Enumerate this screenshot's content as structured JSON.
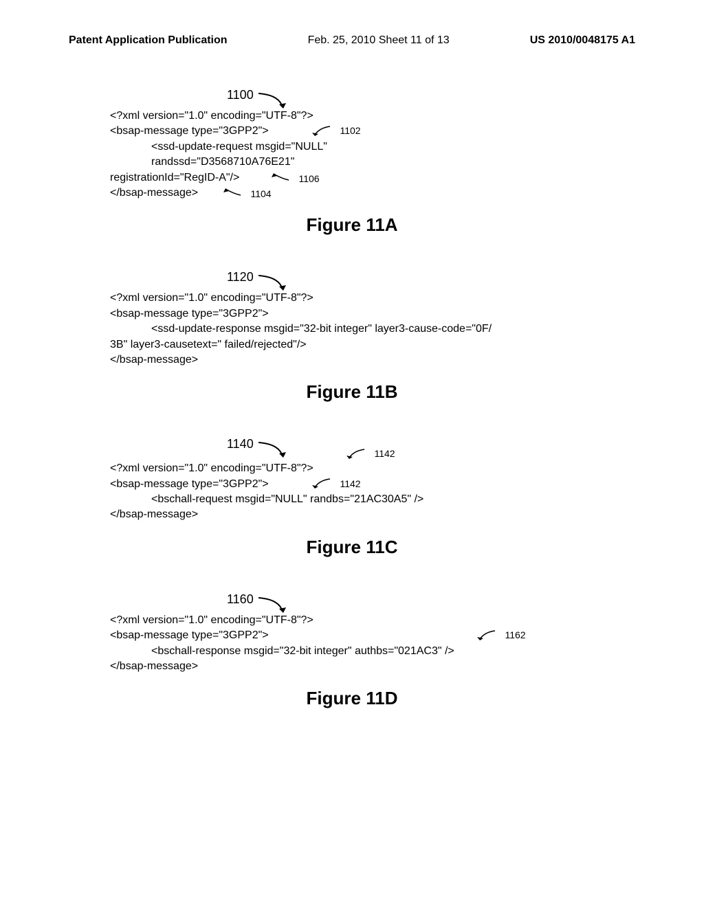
{
  "header": {
    "left": "Patent Application Publication",
    "mid": "Feb. 25, 2010   Sheet 11 of 13",
    "right": "US 2010/0048175 A1"
  },
  "figA": {
    "refnum": "1100",
    "callout1": "1102",
    "callout2": "1106",
    "callout3": "1104",
    "line1": "<?xml version=\"1.0\" encoding=\"UTF-8\"?>",
    "line2": "<bsap-message type=\"3GPP2\">",
    "line3": "<ssd-update-request msgid=\"NULL\"",
    "line4": "randssd=\"D3568710A76E21\"",
    "line5": "registrationId=\"RegID-A\"/>",
    "line6": "</bsap-message>",
    "caption": "Figure 11A"
  },
  "figB": {
    "refnum": "1120",
    "line1": "<?xml version=\"1.0\" encoding=\"UTF-8\"?>",
    "line2": "<bsap-message type=\"3GPP2\">",
    "line3": "<ssd-update-response msgid=\"32-bit integer\" layer3-cause-code=\"0F/",
    "line4": "3B\" layer3-causetext=\" failed/rejected\"/>",
    "line5": "</bsap-message>",
    "caption": "Figure 11B"
  },
  "figC": {
    "refnum": "1140",
    "callout1": "1142",
    "callout2": "1142",
    "line1": "<?xml version=\"1.0\" encoding=\"UTF-8\"?>",
    "line2": "<bsap-message type=\"3GPP2\">",
    "line3": "<bschall-request msgid=\"NULL\" randbs=\"21AC30A5\" />",
    "line4": "</bsap-message>",
    "caption": "Figure 11C"
  },
  "figD": {
    "refnum": "1160",
    "callout1": "1162",
    "line1": "<?xml version=\"1.0\" encoding=\"UTF-8\"?>",
    "line2": "<bsap-message type=\"3GPP2\">",
    "line3": "<bschall-response msgid=\"32-bit integer\" authbs=\"021AC3\" />",
    "line4": "</bsap-message>",
    "caption": "Figure 11D"
  }
}
